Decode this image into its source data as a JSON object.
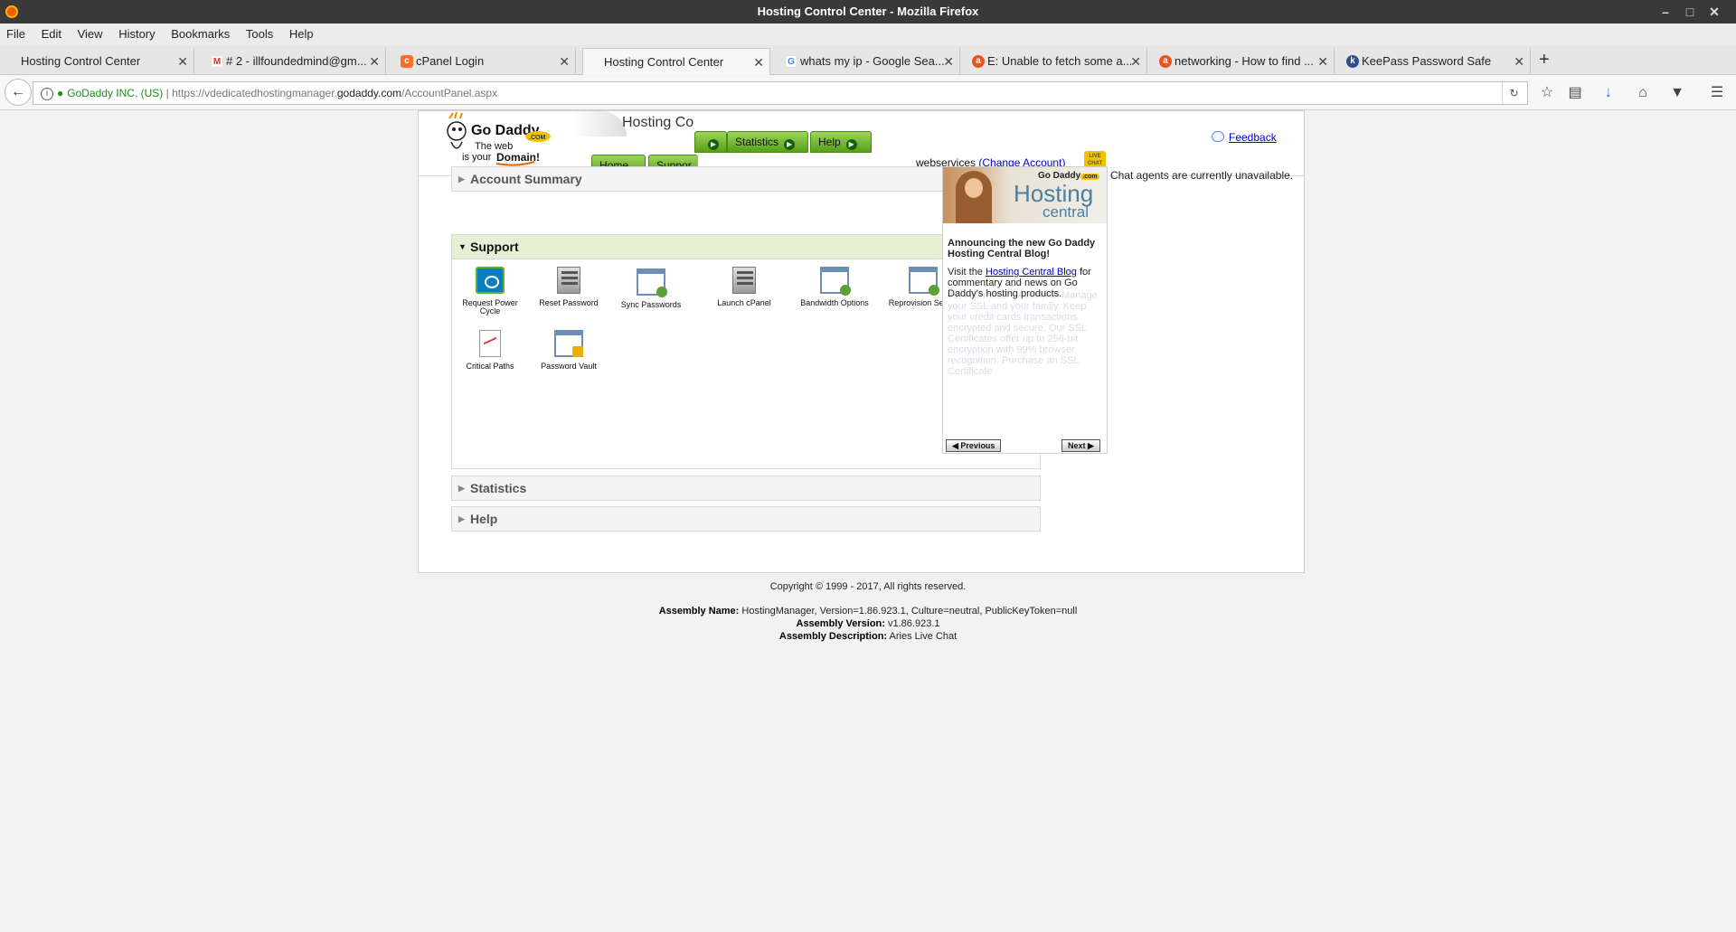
{
  "window": {
    "title": "Hosting Control Center - Mozilla Firefox"
  },
  "menu": [
    "File",
    "Edit",
    "View",
    "History",
    "Bookmarks",
    "Tools",
    "Help"
  ],
  "tabs": [
    {
      "label": "Hosting Control Center",
      "icon": "blank-page-icon"
    },
    {
      "label": "# 2 - illfoundedmind@gm...",
      "icon": "gmail-icon"
    },
    {
      "label": "cPanel Login",
      "icon": "cpanel-icon"
    },
    {
      "label": "Hosting Control Center",
      "icon": "blank-page-icon"
    },
    {
      "label": "whats my ip - Google Sea...",
      "icon": "google-icon"
    },
    {
      "label": "E: Unable to fetch some a...",
      "icon": "askubuntu-icon"
    },
    {
      "label": "networking - How to find ...",
      "icon": "askubuntu-icon"
    },
    {
      "label": "KeePass Password Safe",
      "icon": "keepass-icon"
    }
  ],
  "address": {
    "org": "GoDaddy INC. (US)",
    "prefix": "https://vdedicatedhostingmanager.",
    "host": "godaddy.com",
    "path": "/AccountPanel.aspx"
  },
  "header": {
    "title": "Hosting Con",
    "nav": [
      "Home",
      "Suppor",
      "Statistics",
      "Help"
    ],
    "feedback": "Feedback",
    "account_name": "webservices",
    "change_account": "(Change Account)",
    "chat_badge": "LIVE CHAT",
    "chat_status": "Chat agents are currently unavailable."
  },
  "panels": {
    "account_summary": "Account Summary",
    "support": "Support",
    "statistics": "Statistics",
    "help": "Help"
  },
  "support_icons": [
    {
      "label": "Request Power Cycle",
      "icon": "power-cycle-icon"
    },
    {
      "label": "Reset Password",
      "icon": "reset-password-icon"
    },
    {
      "label": "Sync Passwords",
      "icon": "sync-passwords-icon"
    },
    {
      "label": "Launch cPanel",
      "icon": "cpanel-icon"
    },
    {
      "label": "Bandwidth Options",
      "icon": "bandwidth-icon"
    },
    {
      "label": "Reprovision Server",
      "icon": "reprovision-icon"
    },
    {
      "label": "Critical Paths",
      "icon": "critical-paths-icon"
    },
    {
      "label": "Password Vault",
      "icon": "password-vault-icon"
    }
  ],
  "promo": {
    "brand": "Go Daddy",
    "brand_tld": ".com",
    "heading_1": "Hosting",
    "heading_2": "central",
    "title": "Announcing the new Go Daddy Hosting Central Blog!",
    "text_before": "Visit the ",
    "link": "Hosting Central Blog",
    "text_after": " for commentary and news on Go Daddy's hosting products.",
    "ghost_text": "es, information, Accounts Manage your SSL and your family. Keep your credit cards transactions encrypted and secure. Our SSL Certificates offer up to 256-bit encryption with 99% browser recognition.",
    "ghost_link": "Purchase an SSL Certificate",
    "prev": "Previous",
    "next": "Next"
  },
  "footer": {
    "copyright": "Copyright © 1999 - 2017, All rights reserved.",
    "assembly_name_label": "Assembly Name:",
    "assembly_name": "HostingManager, Version=1.86.923.1, Culture=neutral, PublicKeyToken=null",
    "assembly_version_label": "Assembly Version:",
    "assembly_version": "v1.86.923.1",
    "assembly_description_label": "Assembly Description:",
    "assembly_description": "Aries Live Chat"
  },
  "colors": {
    "nav_green": "#58a01a",
    "link_blue": "#0000cc",
    "secure_green": "#1c8c1c",
    "panel_open": "#e5f0d4"
  }
}
